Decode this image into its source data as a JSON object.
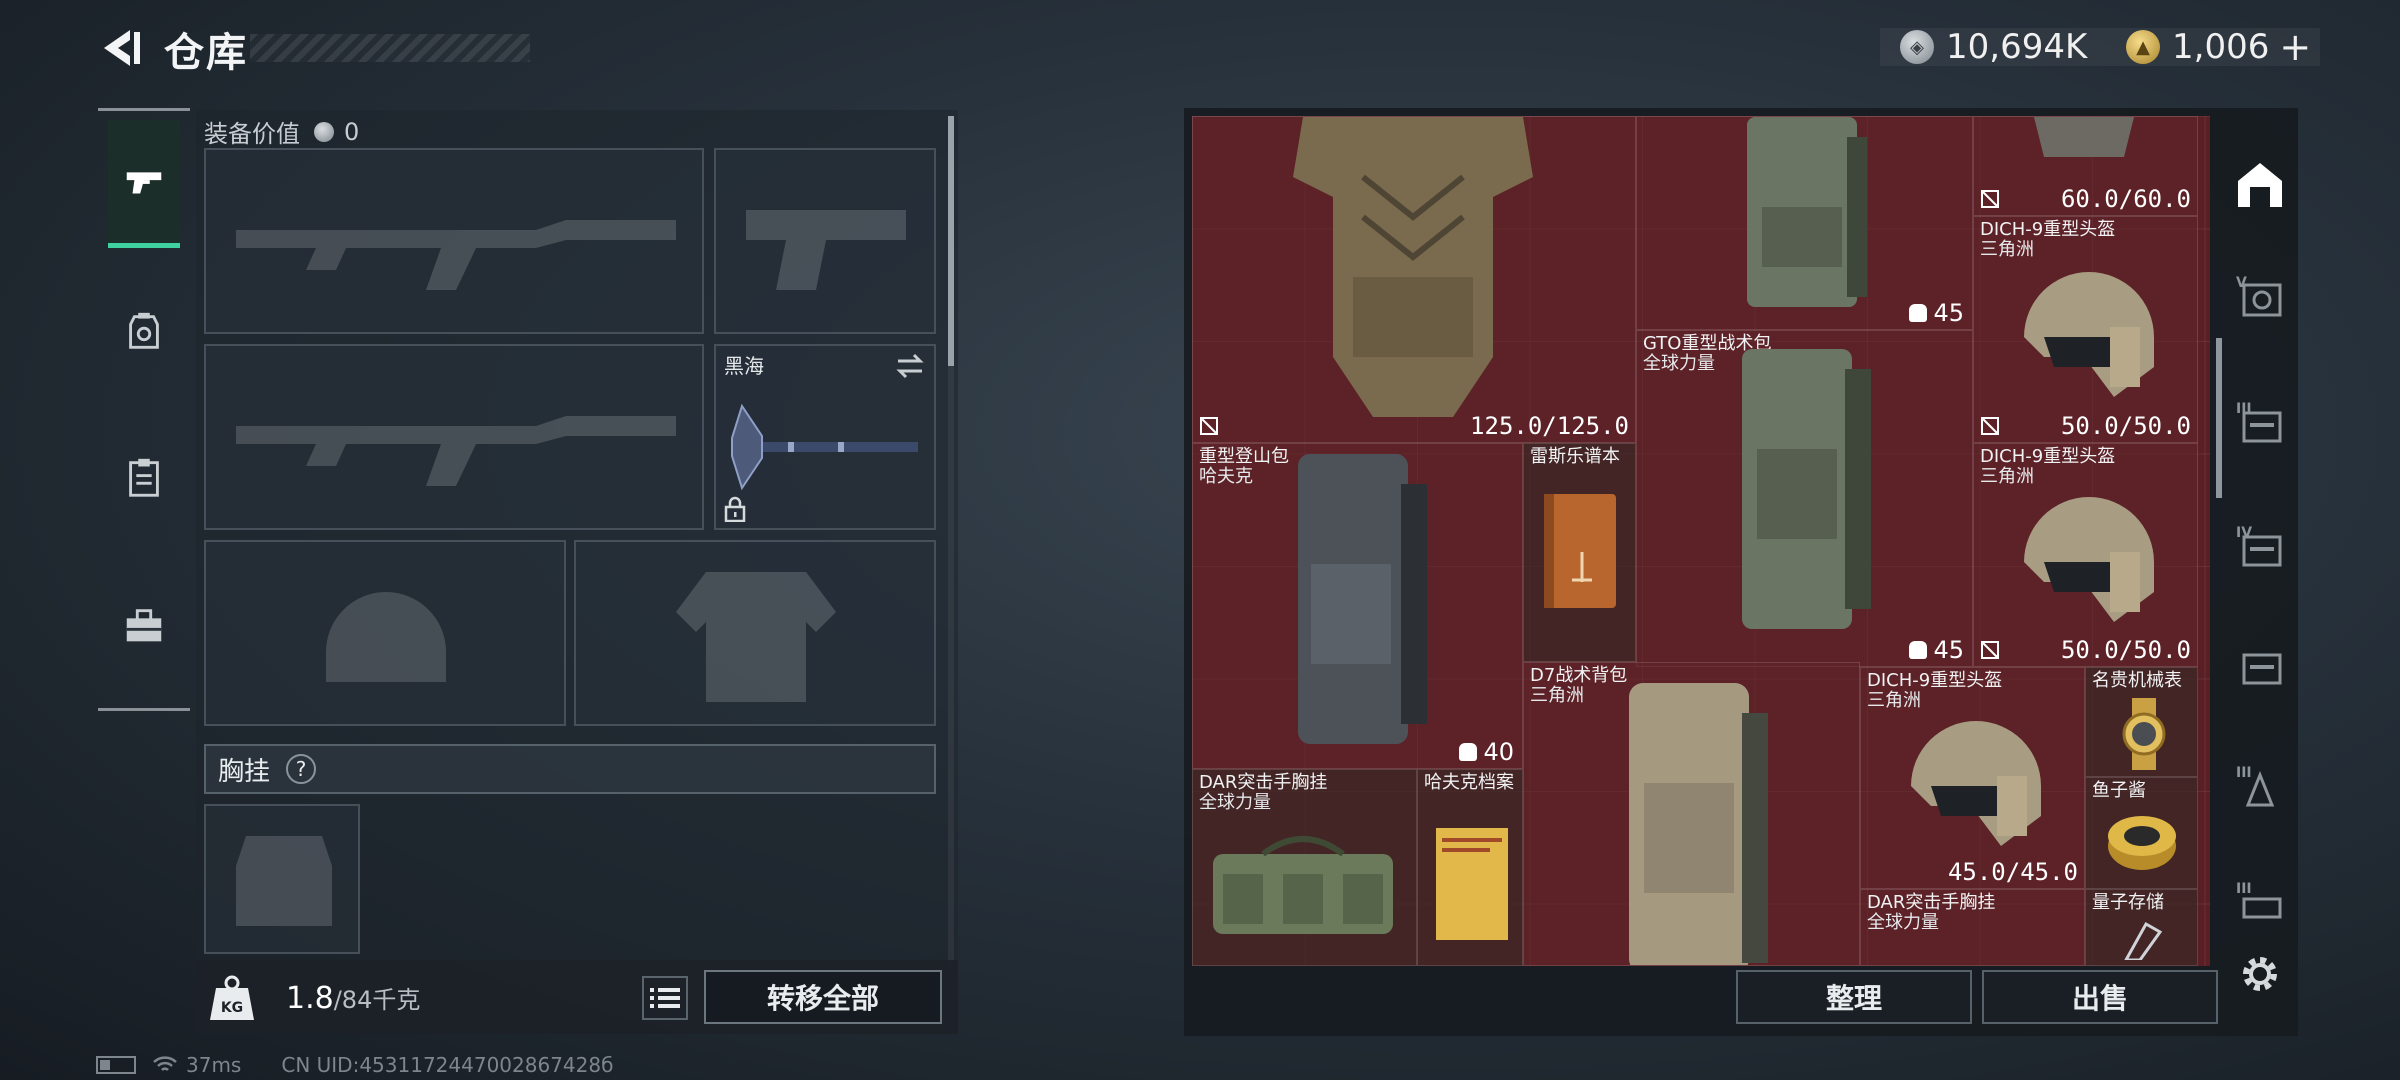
{
  "header": {
    "title": "仓库"
  },
  "currency": {
    "silver_amount": "10,694K",
    "gold_amount": "1,006",
    "plus_label": "+"
  },
  "rail": {
    "items": [
      {
        "icon": "pistol-icon",
        "active": true
      },
      {
        "icon": "helmet-armor-icon",
        "active": false
      },
      {
        "icon": "clipboard-icon",
        "active": false
      },
      {
        "icon": "toolbox-icon",
        "active": false
      }
    ]
  },
  "equipment": {
    "value_label": "装备价值",
    "value": "0",
    "melee_slot_label": "黑海",
    "section_label": "胸挂",
    "help_label": "?",
    "weight_current": "1.8",
    "weight_max": "/84千克",
    "transfer_all_label": "转移全部"
  },
  "stash": {
    "items": [
      {
        "name": "",
        "sub": "",
        "durability": "125.0/125.0"
      },
      {
        "name": "",
        "sub": "",
        "capacity": "45"
      },
      {
        "name": "",
        "sub": "",
        "durability": "60.0/60.0"
      },
      {
        "name": "DICH-9重型头盔",
        "sub": "三角洲",
        "durability": "50.0/50.0"
      },
      {
        "name": "GTO重型战术包",
        "sub": "全球力量",
        "capacity": "45"
      },
      {
        "name": "重型登山包",
        "sub": "哈夫克",
        "capacity": "40"
      },
      {
        "name": "雷斯乐谱本",
        "sub": ""
      },
      {
        "name": "DICH-9重型头盔",
        "sub": "三角洲",
        "durability": "50.0/50.0"
      },
      {
        "name": "D7战术背包",
        "sub": "三角洲"
      },
      {
        "name": "DICH-9重型头盔",
        "sub": "三角洲",
        "durability": "45.0/45.0"
      },
      {
        "name": "名贵机械表",
        "sub": ""
      },
      {
        "name": "DAR突击手胸挂",
        "sub": "全球力量"
      },
      {
        "name": "哈夫克档案",
        "sub": ""
      },
      {
        "name": "鱼子酱",
        "sub": ""
      },
      {
        "name": "DAR突击手胸挂",
        "sub": "全球力量"
      },
      {
        "name": "量子存储",
        "sub": ""
      }
    ],
    "tabs": [
      {
        "icon": "home-stash-icon"
      },
      {
        "icon": "tier-v-stash-icon",
        "label": "V"
      },
      {
        "icon": "tier-iii-stash-icon",
        "label": "III"
      },
      {
        "icon": "tier-iv-stash-icon",
        "label": "IV"
      },
      {
        "icon": "tier-stash-icon",
        "label": ""
      },
      {
        "icon": "tier-iii-b-stash-icon",
        "label": "III"
      },
      {
        "icon": "tier-iii-c-stash-icon",
        "label": "III"
      }
    ],
    "sort_label": "整理",
    "sell_label": "出售"
  },
  "status": {
    "ping": "37ms",
    "uid": "CN UID:4531172447002867428б"
  },
  "colors": {
    "accent": "#3fd1a0",
    "stash_bg": "#5a1f24",
    "gold": "#d9b453"
  }
}
